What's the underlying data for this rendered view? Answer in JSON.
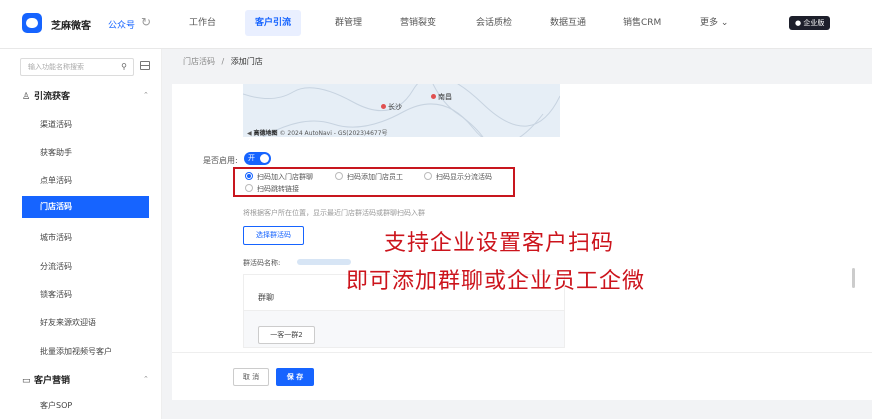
{
  "header": {
    "app_name": "芝麻微客",
    "app_sub": "公众号",
    "nav": [
      "工作台",
      "客户引流",
      "群管理",
      "营销裂变",
      "会话质检",
      "数据互通",
      "销售CRM",
      "更多 ⌄"
    ],
    "active_nav_index": 1,
    "badge": "● 企业版"
  },
  "sidebar": {
    "search_placeholder": "输入功能名称搜索",
    "group1": "引流获客",
    "items": [
      "渠道活码",
      "获客助手",
      "点单活码",
      "门店活码",
      "城市活码",
      "分流活码",
      "锁客活码",
      "好友来源欢迎语",
      "批量添加视频号客户"
    ],
    "active_item_index": 3,
    "group2": "客户营销",
    "next_item": "客户SOP"
  },
  "breadcrumb": {
    "parent": "门店活码",
    "separator": "/",
    "current": "添加门店"
  },
  "map": {
    "city1": "长沙",
    "city2": "南昌",
    "credit_logo": "高德地图",
    "credit_text": "© 2024 AutoNavi - GS(2023)4677号"
  },
  "form": {
    "enable_label": "是否启用:",
    "switch_text": "开",
    "options": [
      "扫码加入门店群聊",
      "扫码添加门店员工",
      "扫码显示分流活码",
      "扫码跳转链接"
    ],
    "selected_option_index": 0,
    "tip": "将根据客户所在位置，显示最近门店群活码或群聊扫码入群",
    "select_button": "选择群活码",
    "code_name_label": "群活码名称:",
    "group_card_head": "群聊",
    "group_tag": "一客一群2"
  },
  "overlay": {
    "line1": "支持企业设置客户扫码",
    "line2": "即可添加群聊或企业员工企微"
  },
  "footer": {
    "cancel": "取 消",
    "save": "保 存"
  },
  "colors": {
    "accent": "#1664ff",
    "highlight": "#cc141c"
  }
}
